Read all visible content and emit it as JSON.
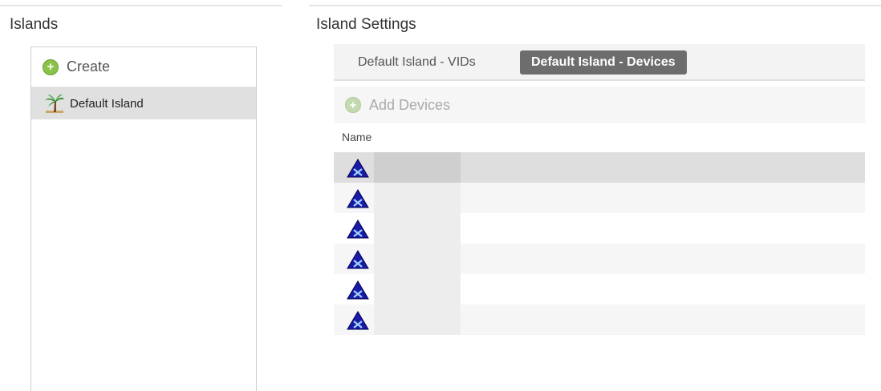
{
  "islands_panel": {
    "title": "Islands",
    "create_label": "Create",
    "items": [
      {
        "label": "Default Island",
        "selected": true
      }
    ]
  },
  "settings_panel": {
    "title": "Island Settings",
    "tabs": [
      {
        "label": "Default Island - VIDs",
        "active": false
      },
      {
        "label": "Default Island - Devices",
        "active": true
      }
    ],
    "add_devices_label": "Add Devices",
    "column_header": "Name",
    "devices": [
      {
        "name": "",
        "selected": true
      },
      {
        "name": ""
      },
      {
        "name": ""
      },
      {
        "name": ""
      },
      {
        "name": ""
      },
      {
        "name": ""
      }
    ]
  },
  "icons": {
    "create": "plus-circle-icon",
    "island": "palm-tree-icon",
    "add_devices": "plus-circle-icon",
    "device": "device-triangle-icon"
  },
  "colors": {
    "accent_green": "#8bc34a",
    "active_tab": "#6d6d6d",
    "device_icon": "#1a1aa8",
    "selected_row": "#dedede"
  }
}
